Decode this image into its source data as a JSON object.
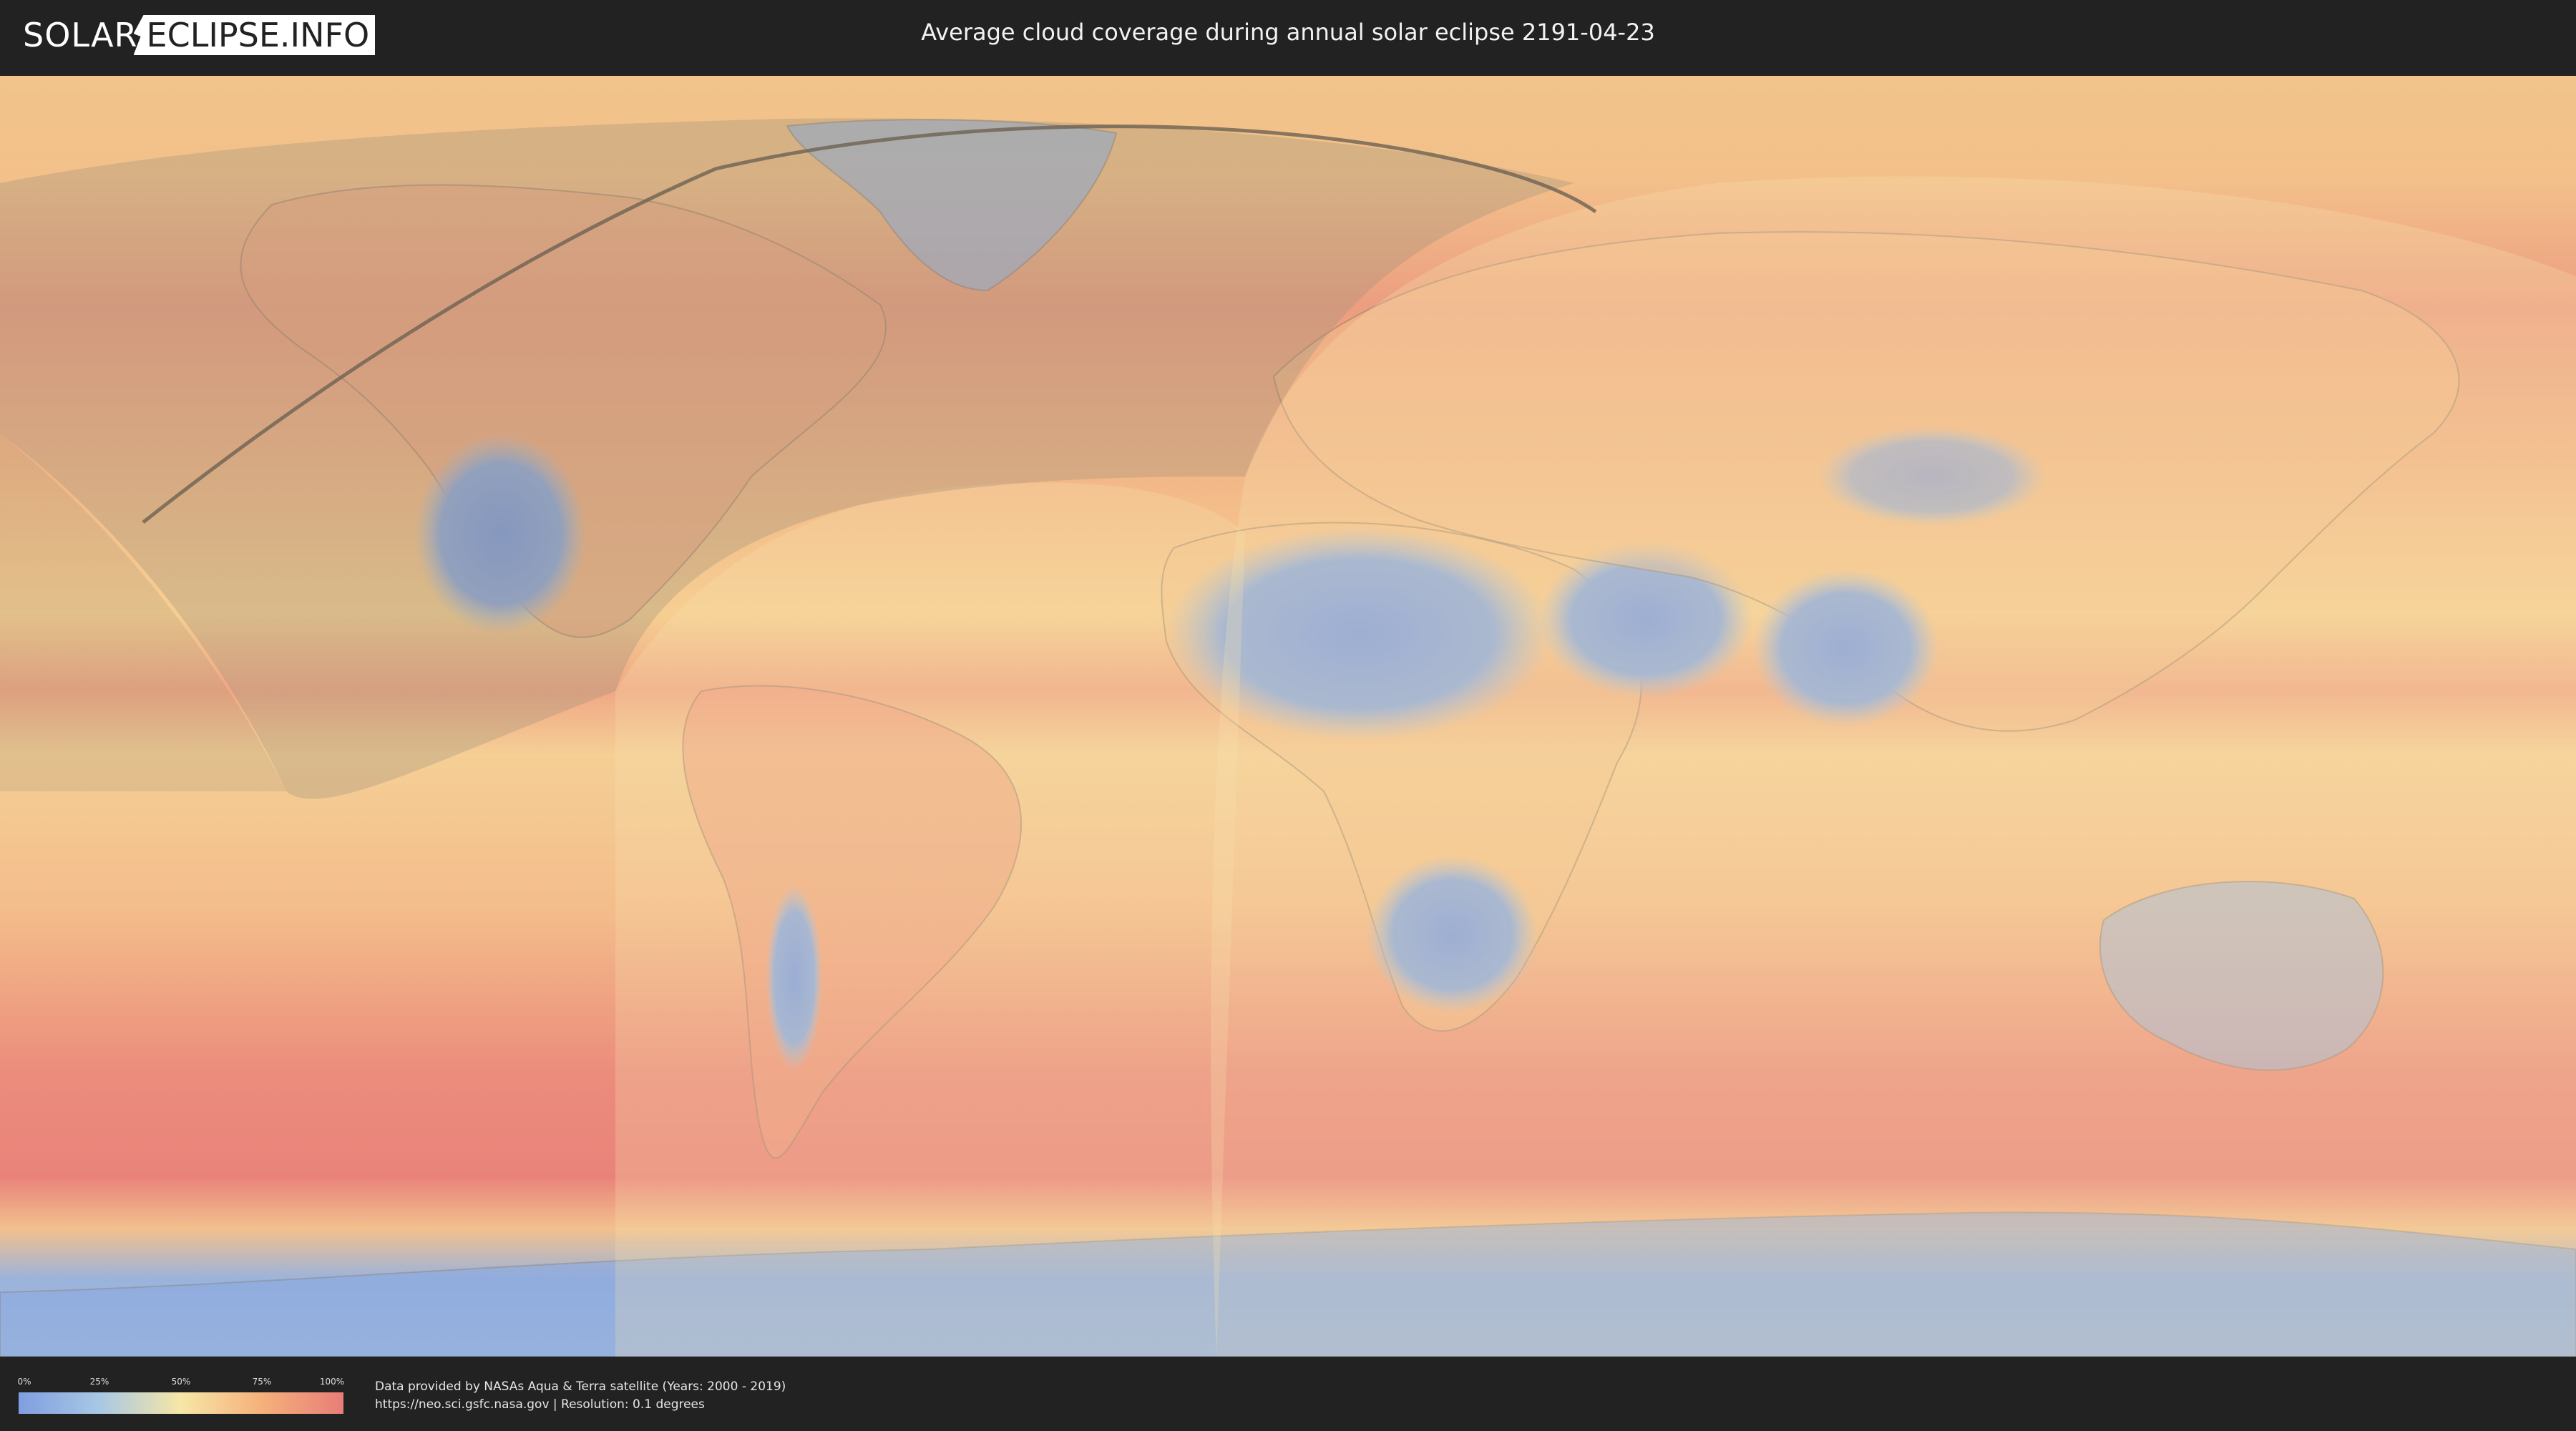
{
  "header": {
    "logo_left": "SOLAR",
    "logo_right": "ECLIPSE.INFO",
    "title": "Average cloud coverage during annual solar eclipse 2191-04-23"
  },
  "legend": {
    "ticks": [
      "0%",
      "25%",
      "50%",
      "75%",
      "100%"
    ],
    "tick_values": [
      0,
      25,
      50,
      75,
      100
    ],
    "colors": [
      "#7f9ee0",
      "#a9c8e4",
      "#f7e6a6",
      "#f5b07b",
      "#e87d78"
    ]
  },
  "credits": {
    "line1": "Data provided by NASAs Aqua & Terra satellite (Years: 2000 - 2019)",
    "line2": "https://neo.sci.gsfc.nasa.gov | Resolution: 0.1 degrees"
  },
  "map": {
    "colors": {
      "ocean_cloudy": "#e8837a",
      "mid": "#f5c28b",
      "clear": "#86a6df",
      "shade": "#bfb08e"
    }
  }
}
